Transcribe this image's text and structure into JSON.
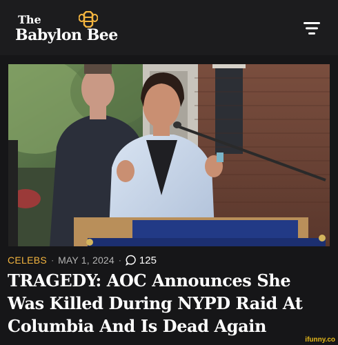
{
  "header": {
    "logo_the": "The",
    "logo_name": "Babylon Bee",
    "menu_icon": "hamburger-menu-icon",
    "logo_icon": "bee-icon"
  },
  "photo": {
    "description_icon": "article-photo"
  },
  "article": {
    "category": "CELEBS",
    "date": "MAY 1, 2024",
    "comment_count": "125",
    "headline": "TRAGEDY: AOC Announces She Was Killed During NYPD Raid At Columbia And Is Dead Again"
  },
  "watermark": "ifunny.co",
  "colors": {
    "background": "#161618",
    "header": "#1c1c1e",
    "category": "#f4b53f",
    "meta_text": "#b5b5b5",
    "logo_bee": "#f4b53f"
  }
}
